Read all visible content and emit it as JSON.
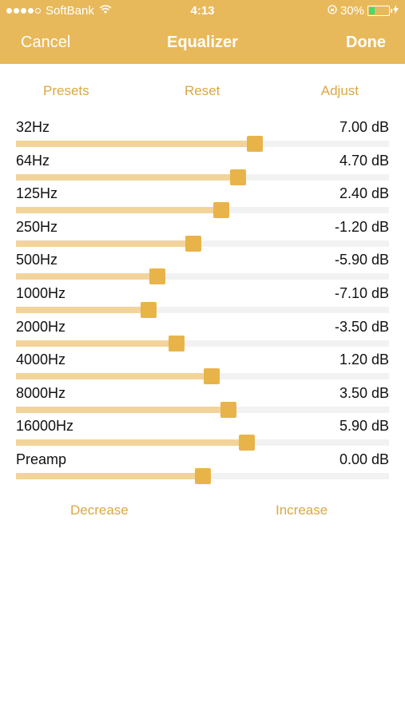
{
  "status": {
    "carrier": "SoftBank",
    "time": "4:13",
    "battery": "30%"
  },
  "nav": {
    "cancel": "Cancel",
    "title": "Equalizer",
    "done": "Done"
  },
  "toolbar": {
    "presets": "Presets",
    "reset": "Reset",
    "adjust": "Adjust"
  },
  "bands": [
    {
      "label": "32Hz",
      "value": "7.00 dB",
      "level": 0.64
    },
    {
      "label": "64Hz",
      "value": "4.70 dB",
      "level": 0.595
    },
    {
      "label": "125Hz",
      "value": "2.40 dB",
      "level": 0.55
    },
    {
      "label": "250Hz",
      "value": "-1.20 dB",
      "level": 0.475
    },
    {
      "label": "500Hz",
      "value": "-5.90 dB",
      "level": 0.38
    },
    {
      "label": "1000Hz",
      "value": "-7.10 dB",
      "level": 0.355
    },
    {
      "label": "2000Hz",
      "value": "-3.50 dB",
      "level": 0.43
    },
    {
      "label": "4000Hz",
      "value": "1.20 dB",
      "level": 0.525
    },
    {
      "label": "8000Hz",
      "value": "3.50 dB",
      "level": 0.57
    },
    {
      "label": "16000Hz",
      "value": "5.90 dB",
      "level": 0.618
    },
    {
      "label": "Preamp",
      "value": "0.00 dB",
      "level": 0.5
    }
  ],
  "bottom": {
    "decrease": "Decrease",
    "increase": "Increase"
  },
  "colors": {
    "accent": "#e8b95a",
    "thumb": "#e8b44a",
    "fill": "#f2d49b",
    "link": "#d9a843"
  }
}
